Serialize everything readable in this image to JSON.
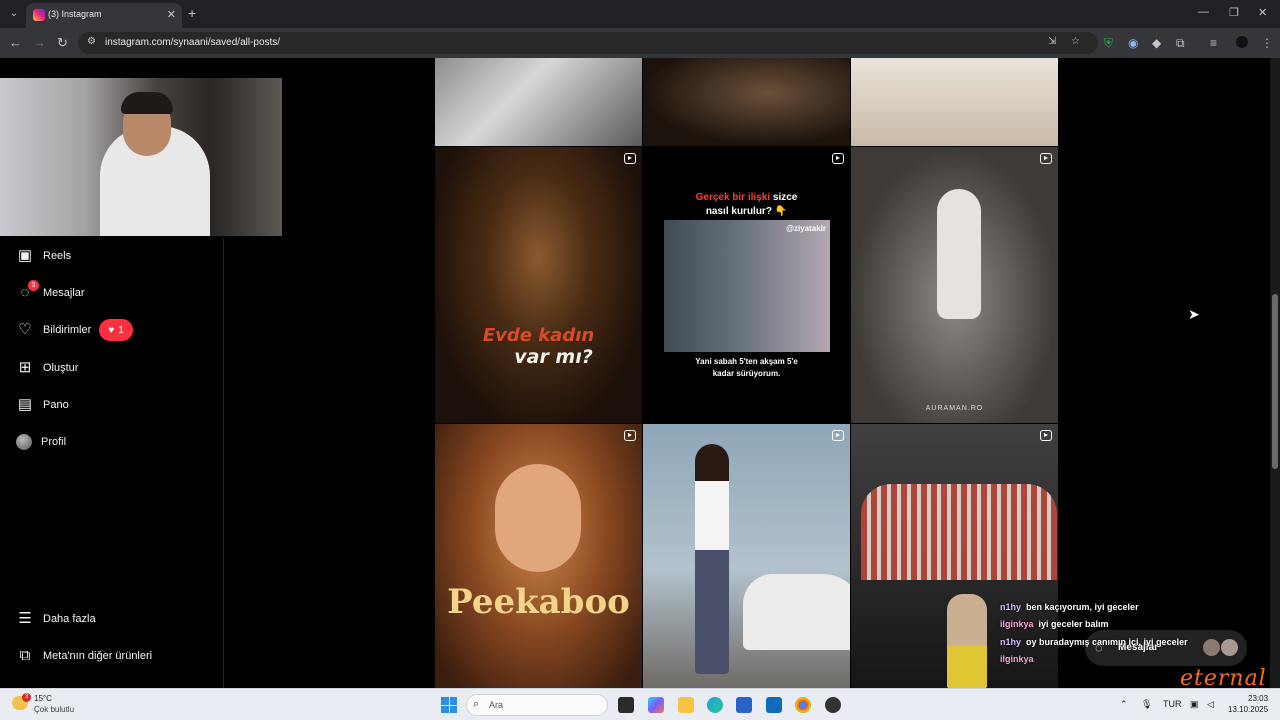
{
  "browser": {
    "tab_title": "(3) Instagram",
    "url": "instagram.com/synaani/saved/all-posts/"
  },
  "sidebar": {
    "items": [
      {
        "label": "Reels"
      },
      {
        "label": "Mesajlar",
        "badge": "3"
      },
      {
        "label": "Bildirimler",
        "pill_count": "1"
      },
      {
        "label": "Oluştur"
      },
      {
        "label": "Pano"
      },
      {
        "label": "Profil"
      }
    ],
    "more_label": "Daha fazla",
    "meta_label": "Meta'nın diğer ürünleri"
  },
  "posts": {
    "evde_line1": "Evde kadın",
    "evde_line2": "var mı?",
    "quote_red": "Gerçek bir ilişki",
    "quote_rest": " sizce",
    "quote_line2": "nasıl kurulur? 👇",
    "handle": "@ziyatakir",
    "caption_line1": "Yani sabah 5'ten akşam 5'e",
    "caption_line2": "kadar sürüyorum.",
    "baby_watermark": "AURAMAN.RO",
    "peekaboo": "Peekaboo"
  },
  "chat": [
    {
      "user": "n1hy",
      "text": "ben kaçıyorum, iyi geceler"
    },
    {
      "user": "ilginkya",
      "text": "iyi geceler balım"
    },
    {
      "user": "n1hy",
      "text": "oy buradaymış canımın içi, iyi geceler"
    },
    {
      "user": "ilginkya",
      "text": ""
    }
  ],
  "messages_pill": {
    "label": "Mesajlar"
  },
  "overlay_brand": "eternal",
  "taskbar": {
    "temperature": "15°C",
    "weather": "Çok bulutlu",
    "weather_badge": "3",
    "search_placeholder": "Ara",
    "language": "TUR",
    "time": "23:03",
    "date": "13.10.2025"
  },
  "colors": {
    "notification_red": "#ff3040",
    "background": "#000000"
  }
}
